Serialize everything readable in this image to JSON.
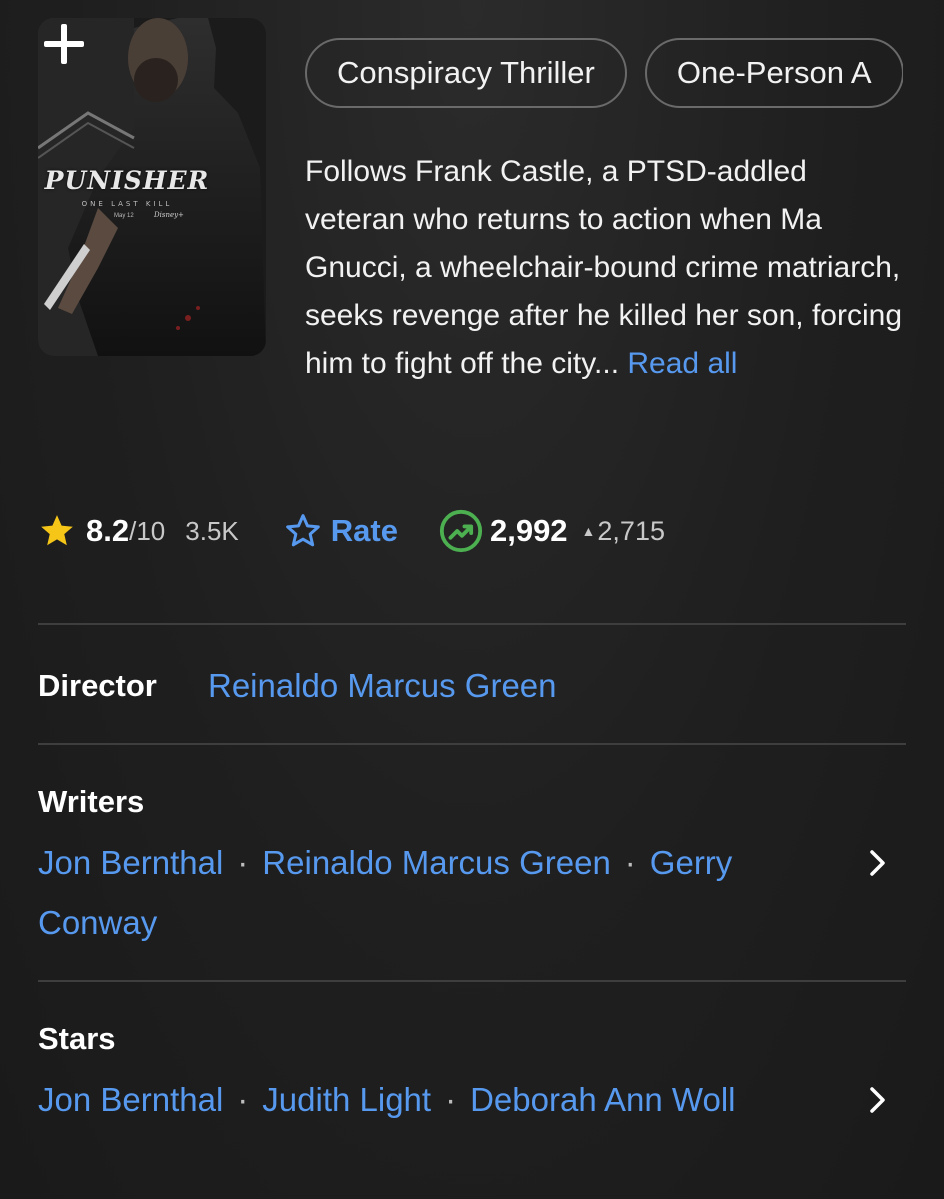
{
  "poster": {
    "title": "PUNISHER",
    "tagline": "ONE LAST KILL",
    "date": "May 12",
    "brand": "Disney+",
    "add_icon": "plus-icon"
  },
  "genres": [
    "Conspiracy Thriller",
    "One-Person A"
  ],
  "plot": {
    "text": "Follows Frank Castle, a PTSD-addled veteran who returns to action when Ma Gnucci, a wheelchair-bound crime matriarch, seeks revenge after he killed her son, forcing him to fight off the city...",
    "read_all": "Read all"
  },
  "rating": {
    "value": "8.2",
    "scale": "/10",
    "votes": "3.5K",
    "rate_label": "Rate",
    "popularity": "2,992",
    "popularity_change_icon": "▲",
    "popularity_change": "2,715"
  },
  "director": {
    "label": "Director",
    "name": "Reinaldo Marcus Green"
  },
  "writers": {
    "label": "Writers",
    "names": [
      "Jon Bernthal",
      "Reinaldo Marcus Green",
      "Gerry Conway"
    ]
  },
  "stars": {
    "label": "Stars",
    "names": [
      "Jon Bernthal",
      "Judith Light",
      "Deborah Ann Woll"
    ]
  },
  "colors": {
    "link": "#5799ef",
    "star": "#f5c518",
    "trend": "#4caf50",
    "background": "#1f1f1f"
  }
}
